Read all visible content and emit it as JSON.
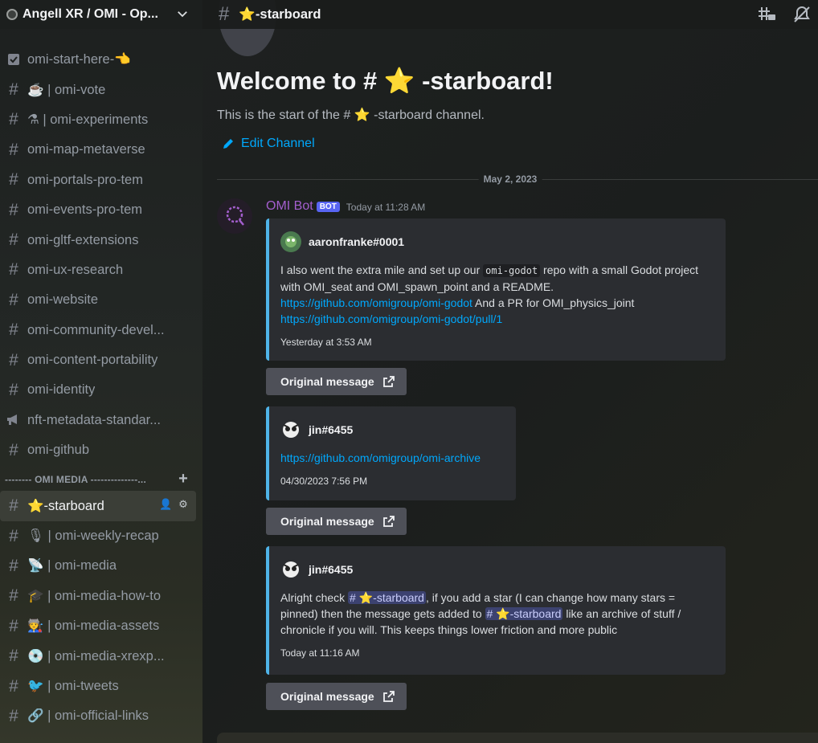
{
  "server": {
    "name": "Angell XR / OMI - Op..."
  },
  "sidebar": {
    "channels": [
      {
        "label": "omi-start-here-👈",
        "icon": "rules-icon"
      },
      {
        "label": "☕ | omi-vote",
        "icon": "hash-icon"
      },
      {
        "label": "⚗ | omi-experiments",
        "icon": "hash-threads-icon"
      },
      {
        "label": "omi-map-metaverse",
        "icon": "hash-icon"
      },
      {
        "label": "omi-portals-pro-tem",
        "icon": "hash-icon"
      },
      {
        "label": "omi-events-pro-tem",
        "icon": "hash-icon"
      },
      {
        "label": "omi-gltf-extensions",
        "icon": "hash-threads-icon"
      },
      {
        "label": "omi-ux-research",
        "icon": "hash-icon"
      },
      {
        "label": "omi-website",
        "icon": "hash-icon"
      },
      {
        "label": "omi-community-devel...",
        "icon": "hash-threads-icon"
      },
      {
        "label": "omi-content-portability",
        "icon": "hash-icon"
      },
      {
        "label": "omi-identity",
        "icon": "hash-icon"
      },
      {
        "label": "nft-metadata-standar...",
        "icon": "announcement-icon"
      },
      {
        "label": "omi-github",
        "icon": "hash-icon"
      }
    ],
    "category": "-------- OMI MEDIA --------------...",
    "media_channels": [
      {
        "label": "⭐-starboard",
        "icon": "hash-icon",
        "active": true
      },
      {
        "label": "🎙 | omi-weekly-recap",
        "icon": "hash-icon"
      },
      {
        "label": "📡 | omi-media",
        "icon": "hash-icon"
      },
      {
        "label": "🎓 | omi-media-how-to",
        "icon": "hash-icon"
      },
      {
        "label": "🧑‍🏭 | omi-media-assets",
        "icon": "hash-icon"
      },
      {
        "label": "💿 | omi-media-xrexp...",
        "icon": "hash-icon"
      },
      {
        "label": "🐦 | omi-tweets",
        "icon": "hash-icon"
      },
      {
        "label": "🔗 | omi-official-links",
        "icon": "hash-threads-icon"
      }
    ]
  },
  "topbar": {
    "title": "⭐-starboard"
  },
  "welcome": {
    "title": "Welcome to # ⭐ -starboard!",
    "subtitle": "This is the start of the # ⭐ -starboard channel.",
    "edit_label": "Edit Channel"
  },
  "date_divider": "May 2, 2023",
  "message": {
    "author": "OMI Bot",
    "tag": "BOT",
    "timestamp": "Today at 11:28 AM"
  },
  "embeds": [
    {
      "author": "aaronfranke#0001",
      "text_a": "I also went the extra mile and set up our ",
      "code": "omi-godot",
      "text_b": " repo with a small Godot project with OMI_seat and OMI_spawn_point and a README.",
      "link1": "https://github.com/omigroup/omi-godot",
      "text_c": " And a PR for OMI_physics_joint",
      "link2": "https://github.com/omigroup/omi-godot/pull/1",
      "footer": "Yesterday at 3:53 AM"
    },
    {
      "author": "jin#6455",
      "link1": "https://github.com/omigroup/omi-archive",
      "footer": "04/30/2023 7:56 PM"
    },
    {
      "author": "jin#6455",
      "text_a": "Alright check ",
      "mention": "# ⭐-starboard",
      "text_b": ", if you add a star (I can change how many stars = pinned) then the message gets added to ",
      "text_c": " like an archive of stuff / chronicle if you will. This keeps things lower friction and more public",
      "footer": "Today at 11:16 AM"
    }
  ],
  "original_button": "Original message",
  "colors": {
    "accent_link": "#00a8fc",
    "embed_border": "#4fb4e8",
    "bot_author": "#a45fce",
    "bot_tag": "#5865f2"
  }
}
